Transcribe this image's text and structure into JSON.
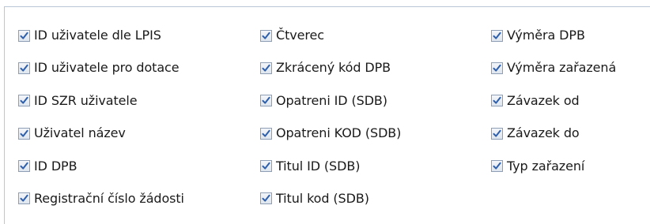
{
  "options": {
    "columns": [
      {
        "items": [
          {
            "label": "ID uživatele dle LPIS",
            "checked": true
          },
          {
            "label": "ID uživatele pro dotace",
            "checked": true
          },
          {
            "label": "ID SZR uživatele",
            "checked": true
          },
          {
            "label": "Uživatel název",
            "checked": true
          },
          {
            "label": "ID DPB",
            "checked": true
          },
          {
            "label": "Registrační číslo žádosti",
            "checked": true
          }
        ]
      },
      {
        "items": [
          {
            "label": "Čtverec",
            "checked": true
          },
          {
            "label": "Zkrácený kód DPB",
            "checked": true
          },
          {
            "label": "Opatreni ID (SDB)",
            "checked": true
          },
          {
            "label": "Opatreni KOD (SDB)",
            "checked": true
          },
          {
            "label": "Titul ID (SDB)",
            "checked": true
          },
          {
            "label": "Titul kod (SDB)",
            "checked": true
          }
        ]
      },
      {
        "items": [
          {
            "label": "Výměra DPB",
            "checked": true
          },
          {
            "label": "Výměra zařazená",
            "checked": true
          },
          {
            "label": "Závazek od",
            "checked": true
          },
          {
            "label": "Závazek do",
            "checked": true
          },
          {
            "label": "Typ zařazení",
            "checked": true
          }
        ]
      }
    ]
  },
  "colors": {
    "panel_border": "#b9c6d6",
    "check_mark": "#2f5fa8"
  }
}
